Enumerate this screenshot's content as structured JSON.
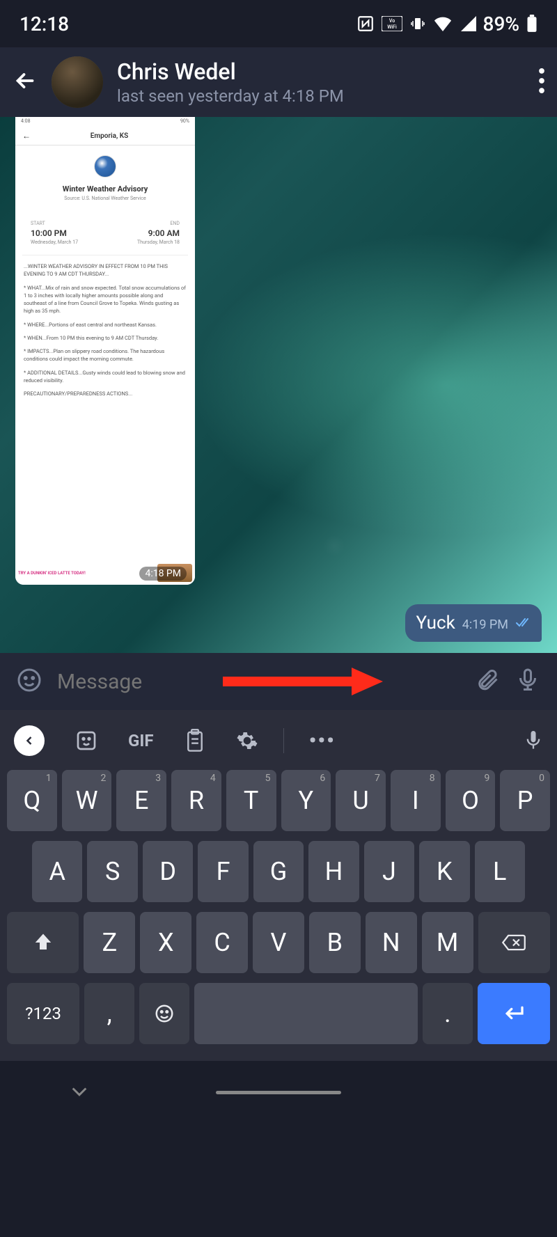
{
  "status": {
    "time": "12:18",
    "battery": "89%"
  },
  "header": {
    "name": "Chris Wedel",
    "status": "last seen yesterday at 4:18 PM"
  },
  "screenshot": {
    "ss_time": "4:08",
    "ss_batt": "90%",
    "location": "Emporia, KS",
    "title": "Winter Weather Advisory",
    "source": "Source: U.S. National Weather Service",
    "start_label": "START",
    "start_time": "10:00 PM",
    "start_date": "Wednesday, March 17",
    "end_label": "END",
    "end_time": "9:00 AM",
    "end_date": "Thursday, March 18",
    "advisory": "...WINTER WEATHER ADVISORY IN EFFECT FROM 10 PM THIS EVENING TO 9 AM CDT THURSDAY...",
    "what": "* WHAT...Mix of rain and snow expected. Total snow accumulations of 1 to 3 inches with locally higher amounts possible along and southeast of a line from Council Grove to Topeka. Winds gusting as high as 35 mph.",
    "where": "* WHERE...Portions of east central and northeast Kansas.",
    "when": "* WHEN...From 10 PM this evening to 9 AM CDT Thursday.",
    "impacts": "* IMPACTS...Plan on slippery road conditions. The hazardous conditions could impact the morning commute.",
    "details": "* ADDITIONAL DETAILS...Gusty winds could lead to blowing snow and reduced visibility.",
    "precaution": "PRECAUTIONARY/PREPAREDNESS ACTIONS...",
    "ad_text": "TRY A DUNKIN' ICED LATTE TODAY!",
    "msg_time": "4:18 PM"
  },
  "outgoing": {
    "text": "Yuck",
    "time": "4:19 PM"
  },
  "input": {
    "placeholder": "Message"
  },
  "keyboard": {
    "gif": "GIF",
    "row1": [
      {
        "k": "Q",
        "n": "1"
      },
      {
        "k": "W",
        "n": "2"
      },
      {
        "k": "E",
        "n": "3"
      },
      {
        "k": "R",
        "n": "4"
      },
      {
        "k": "T",
        "n": "5"
      },
      {
        "k": "Y",
        "n": "6"
      },
      {
        "k": "U",
        "n": "7"
      },
      {
        "k": "I",
        "n": "8"
      },
      {
        "k": "O",
        "n": "9"
      },
      {
        "k": "P",
        "n": "0"
      }
    ],
    "row2": [
      "A",
      "S",
      "D",
      "F",
      "G",
      "H",
      "J",
      "K",
      "L"
    ],
    "row3": [
      "Z",
      "X",
      "C",
      "V",
      "B",
      "N",
      "M"
    ],
    "sym": "?123",
    "comma": ",",
    "period": "."
  }
}
